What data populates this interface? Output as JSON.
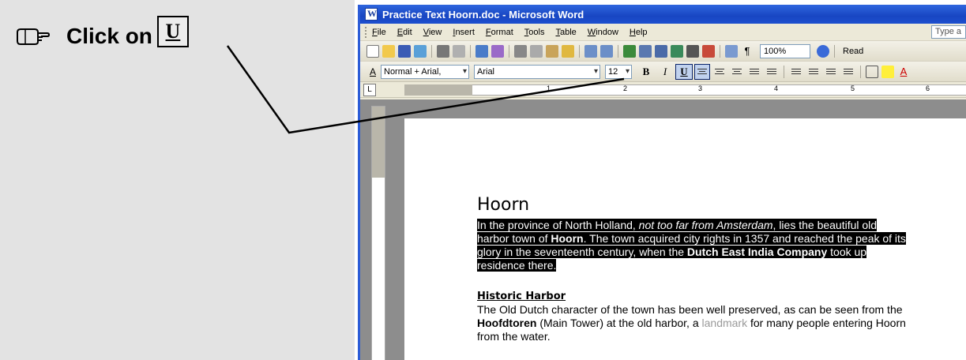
{
  "instruction": {
    "text": "Click on",
    "button_glyph": "U",
    "icon": "pointing-hand-icon"
  },
  "window": {
    "title": "Practice Text Hoorn.doc - Microsoft Word"
  },
  "menu": {
    "items": [
      "File",
      "Edit",
      "View",
      "Insert",
      "Format",
      "Tools",
      "Table",
      "Window",
      "Help"
    ],
    "ask_box": "Type a"
  },
  "toolbar": {
    "zoom": "100%",
    "read_label": "Read"
  },
  "formatting": {
    "style": "Normal + Arial,",
    "font": "Arial",
    "size": "12",
    "bold": "B",
    "italic": "I",
    "underline": "U"
  },
  "ruler": {
    "numbers": [
      "1",
      "2",
      "3",
      "4",
      "5",
      "6"
    ]
  },
  "document": {
    "heading": "Hoorn",
    "para1": {
      "line1_a": "In the province of North Holland, ",
      "line1_b": "not too far from Amsterdam",
      "line1_c": ", lies the beautiful old",
      "line2_a": "harbor town of ",
      "line2_b": "Hoorn",
      "line2_c": ". The town acquired city rights in 1357 and reached the peak of its",
      "line3_a": "glory in the seventeenth century, when the ",
      "line3_b": "Dutch East India Company",
      "line3_c": " took up",
      "line4": "residence there. "
    },
    "subheading": "Historic Harbor",
    "para2": {
      "line1": "The Old Dutch character of the town has been well preserved, as can be seen from the",
      "line2_a": "Hoofdtoren",
      "line2_b": " (Main Tower) at the old harbor, a ",
      "line2_c": "landmark",
      "line2_d": " for many people entering Hoorn",
      "line3": "from the water."
    }
  },
  "colors": {
    "panel_bg": "#e3e3e3",
    "title_bar": "#1846c2",
    "selection": "#000000"
  }
}
